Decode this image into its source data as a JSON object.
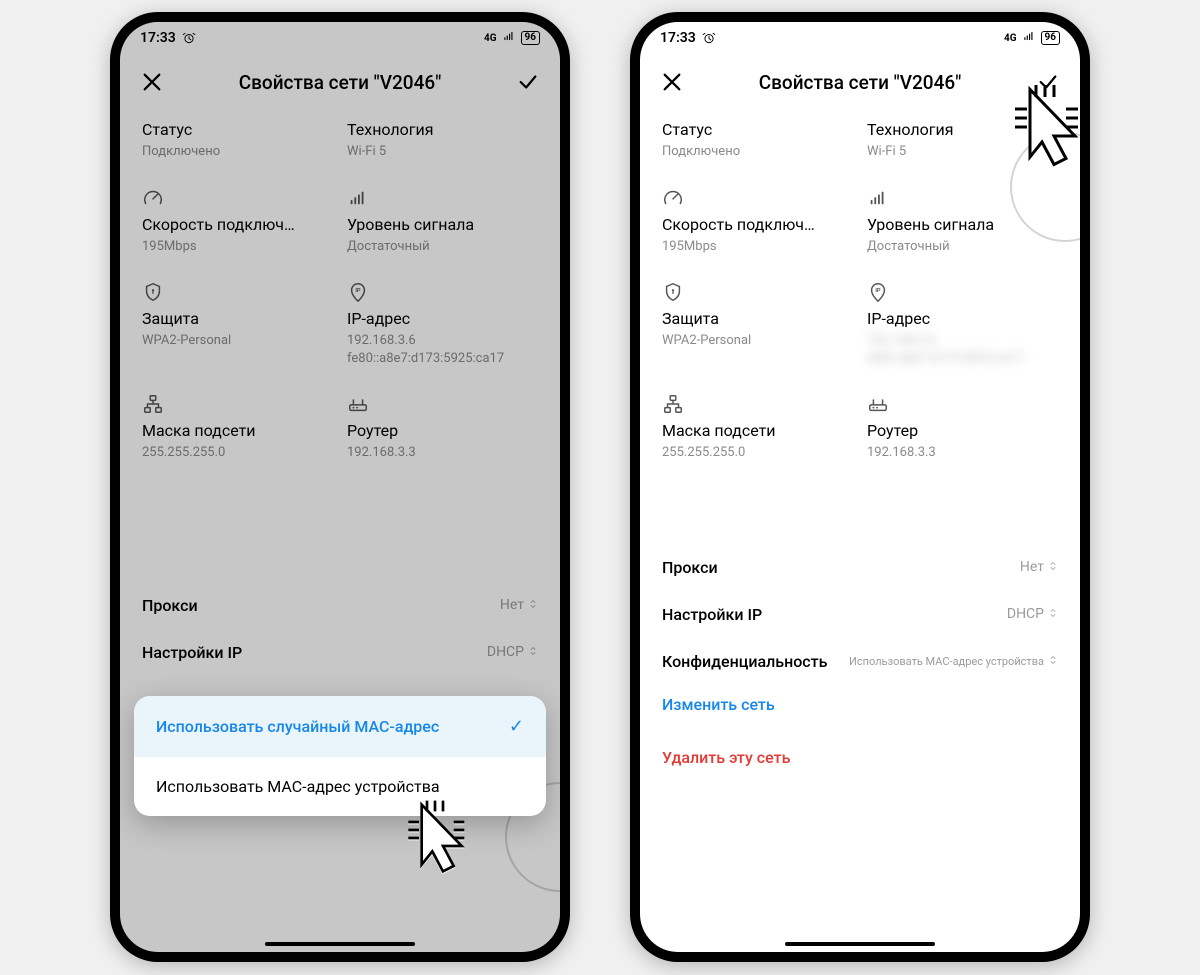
{
  "statusbar": {
    "time": "17:33",
    "signal_label": "4G",
    "battery": "96"
  },
  "header": {
    "title": "Свойства сети \"V2046\""
  },
  "fields": {
    "status": {
      "label": "Статус",
      "value": "Подключено"
    },
    "tech": {
      "label": "Технология",
      "value": "Wi-Fi 5"
    },
    "speed": {
      "label": "Скорость подключ…",
      "value": "195Mbps"
    },
    "signal": {
      "label": "Уровень сигнала",
      "value": "Достаточный"
    },
    "security": {
      "label": "Защита",
      "value": "WPA2-Personal"
    },
    "ip": {
      "label": "IP-адрес",
      "value": "192.168.3.6\nfe80::a8e7:d173:5925:ca17"
    },
    "mask": {
      "label": "Маска подсети",
      "value": "255.255.255.0"
    },
    "router": {
      "label": "Роутер",
      "value": "192.168.3.3"
    }
  },
  "rows": {
    "proxy": {
      "label": "Прокси",
      "value": "Нет"
    },
    "ip_cfg": {
      "label": "Настройки IP",
      "value": "DHCP"
    },
    "privacy": {
      "label": "Конфиденциальность",
      "value": "Использовать MAC-адрес устройства"
    }
  },
  "popup": {
    "opt_random": "Использовать случайный MAC-адрес",
    "opt_device": "Использовать MAC-адрес устройства"
  },
  "actions": {
    "edit": "Изменить сеть",
    "delete": "Удалить эту сеть"
  }
}
